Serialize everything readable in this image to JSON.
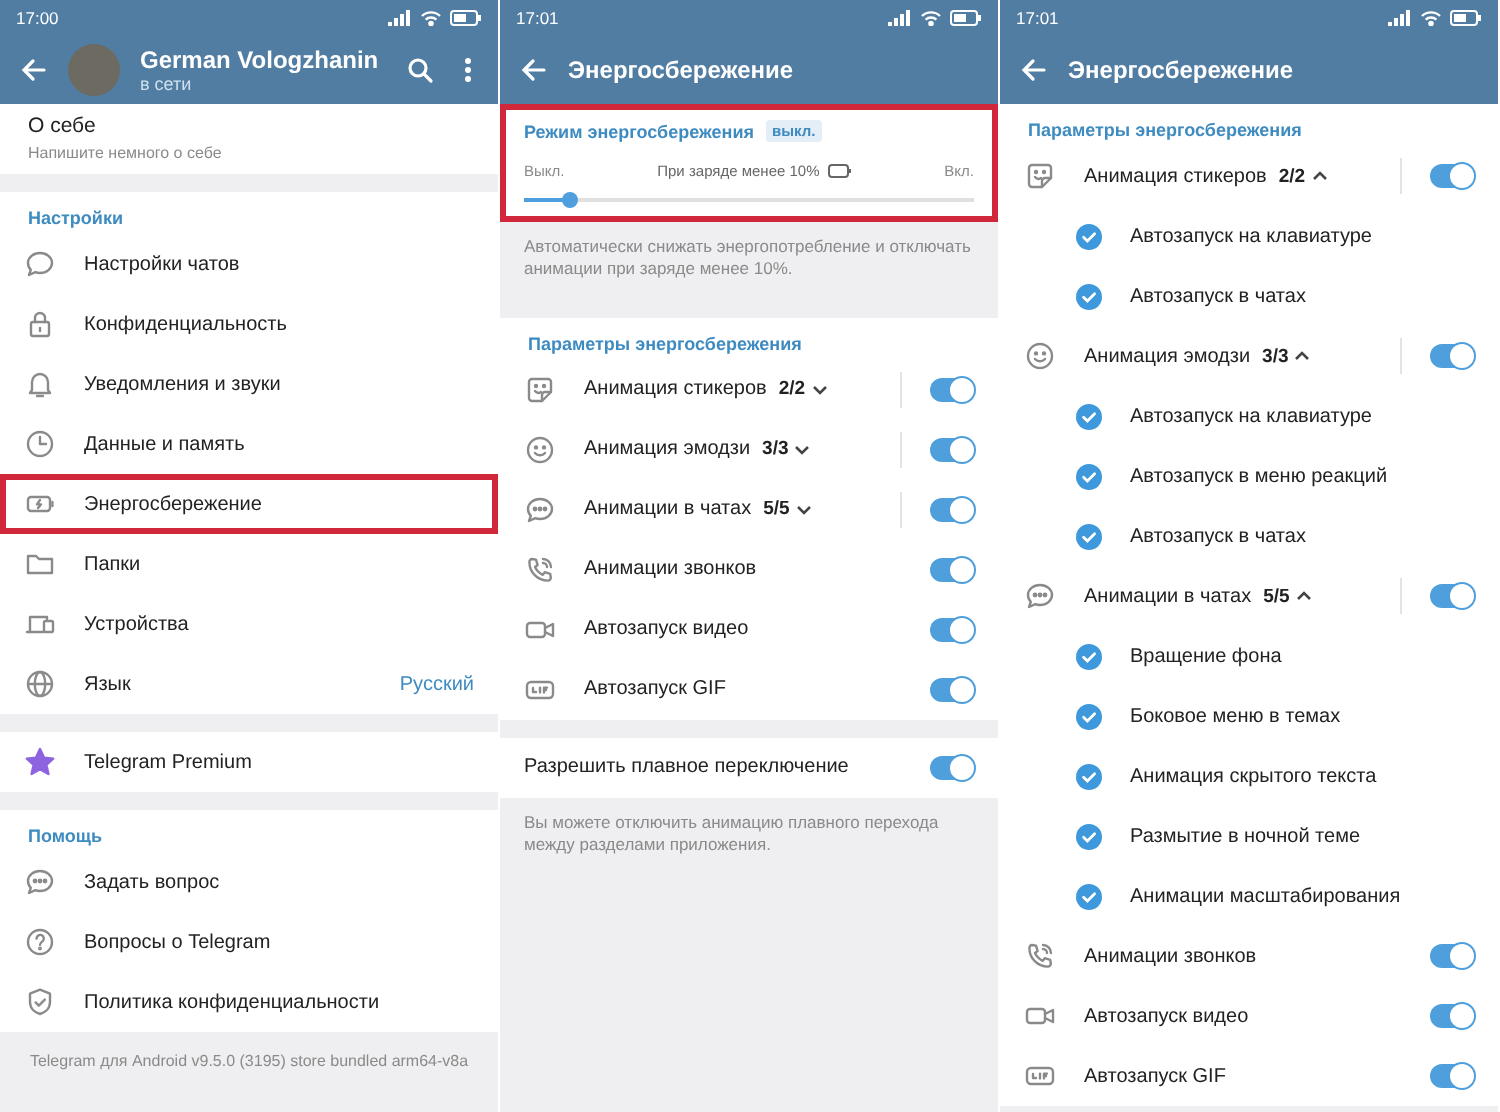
{
  "panels": [
    {
      "status_time": "17:00",
      "header": {
        "title": "German Vologzhanin",
        "subtitle": "в сети"
      },
      "blocks": [
        {
          "kind": "about",
          "title": "О себе",
          "hint": "Напишите немного о себе"
        },
        {
          "kind": "section",
          "heading": "Настройки",
          "items": [
            {
              "kind": "nav",
              "label": "Настройки чатов",
              "highlighted": false
            },
            {
              "kind": "nav",
              "label": "Конфиденциальность",
              "highlighted": false
            },
            {
              "kind": "nav",
              "label": "Уведомления и звуки",
              "highlighted": false
            },
            {
              "kind": "nav",
              "label": "Данные и память",
              "highlighted": false
            },
            {
              "kind": "nav",
              "label": "Энергосбережение",
              "highlighted": true
            },
            {
              "kind": "nav",
              "label": "Папки",
              "highlighted": false
            },
            {
              "kind": "nav",
              "label": "Устройства",
              "highlighted": false
            },
            {
              "kind": "nav",
              "label": "Язык",
              "value": "Русский",
              "highlighted": false
            }
          ]
        },
        {
          "kind": "section",
          "items": [
            {
              "kind": "nav",
              "label": "Telegram Premium",
              "highlighted": false
            }
          ]
        },
        {
          "kind": "section",
          "heading": "Помощь",
          "items": [
            {
              "kind": "nav",
              "label": "Задать вопрос",
              "highlighted": false
            },
            {
              "kind": "nav",
              "label": "Вопросы о Telegram",
              "highlighted": false
            },
            {
              "kind": "nav",
              "label": "Политика конфиденциальности",
              "highlighted": false
            }
          ]
        },
        {
          "kind": "footer",
          "text": "Telegram для Android v9.5.0 (3195) store bundled arm64-v8a"
        }
      ]
    },
    {
      "status_time": "17:01",
      "header": {
        "title": "Энергосбережение"
      },
      "blocks": [
        {
          "kind": "mode",
          "title": "Режим энергосбережения",
          "badge": "выкл.",
          "highlighted": true,
          "left": "Выкл.",
          "middle": "При заряде менее 10%",
          "right": "Вкл.",
          "level": 0.1
        },
        {
          "kind": "hint",
          "text": "Автоматически снижать энергопотребление и отключать анимации при заряде менее 10%."
        },
        {
          "kind": "section",
          "heading": "Параметры энергосбережения",
          "items": [
            {
              "kind": "toggle",
              "label": "Анимация стикеров",
              "count": "2/2",
              "expanded": false,
              "on": true
            },
            {
              "kind": "toggle",
              "label": "Анимация эмодзи",
              "count": "3/3",
              "expanded": false,
              "on": true
            },
            {
              "kind": "toggle",
              "label": "Анимации в чатах",
              "count": "5/5",
              "expanded": false,
              "on": true
            },
            {
              "kind": "toggle",
              "label": "Анимации звонков",
              "on": true
            },
            {
              "kind": "toggle",
              "label": "Автозапуск видео",
              "on": true
            },
            {
              "kind": "toggle",
              "label": "Автозапуск GIF",
              "on": true
            }
          ]
        },
        {
          "kind": "section",
          "items": [
            {
              "kind": "toggle",
              "label": "Разрешить плавное переключение",
              "on": true
            }
          ]
        },
        {
          "kind": "hint",
          "text": "Вы можете отключить анимацию плавного перехода между разделами приложения."
        }
      ]
    },
    {
      "status_time": "17:01",
      "header": {
        "title": "Энергосбережение"
      },
      "blocks": [
        {
          "kind": "section",
          "heading": "Параметры энергосбережения",
          "items": [
            {
              "kind": "toggle",
              "label": "Анимация стикеров",
              "count": "2/2",
              "expanded": true,
              "on": true,
              "options": [
                {
                  "label": "Автозапуск на клавиатуре",
                  "checked": true
                },
                {
                  "label": "Автозапуск в чатах",
                  "checked": true
                }
              ]
            },
            {
              "kind": "toggle",
              "label": "Анимация эмодзи",
              "count": "3/3",
              "expanded": true,
              "on": true,
              "options": [
                {
                  "label": "Автозапуск на клавиатуре",
                  "checked": true
                },
                {
                  "label": "Автозапуск в меню реакций",
                  "checked": true
                },
                {
                  "label": "Автозапуск в чатах",
                  "checked": true
                }
              ]
            },
            {
              "kind": "toggle",
              "label": "Анимации в чатах",
              "count": "5/5",
              "expanded": true,
              "on": true,
              "options": [
                {
                  "label": "Вращение фона",
                  "checked": true
                },
                {
                  "label": "Боковое меню в темах",
                  "checked": true
                },
                {
                  "label": "Анимация скрытого текста",
                  "checked": true
                },
                {
                  "label": "Размытие в ночной теме",
                  "checked": true
                },
                {
                  "label": "Анимации масштабирования",
                  "checked": true
                }
              ]
            },
            {
              "kind": "toggle",
              "label": "Анимации звонков",
              "on": true
            },
            {
              "kind": "toggle",
              "label": "Автозапуск видео",
              "on": true
            },
            {
              "kind": "toggle",
              "label": "Автозапуск GIF",
              "on": true
            }
          ]
        }
      ]
    }
  ]
}
